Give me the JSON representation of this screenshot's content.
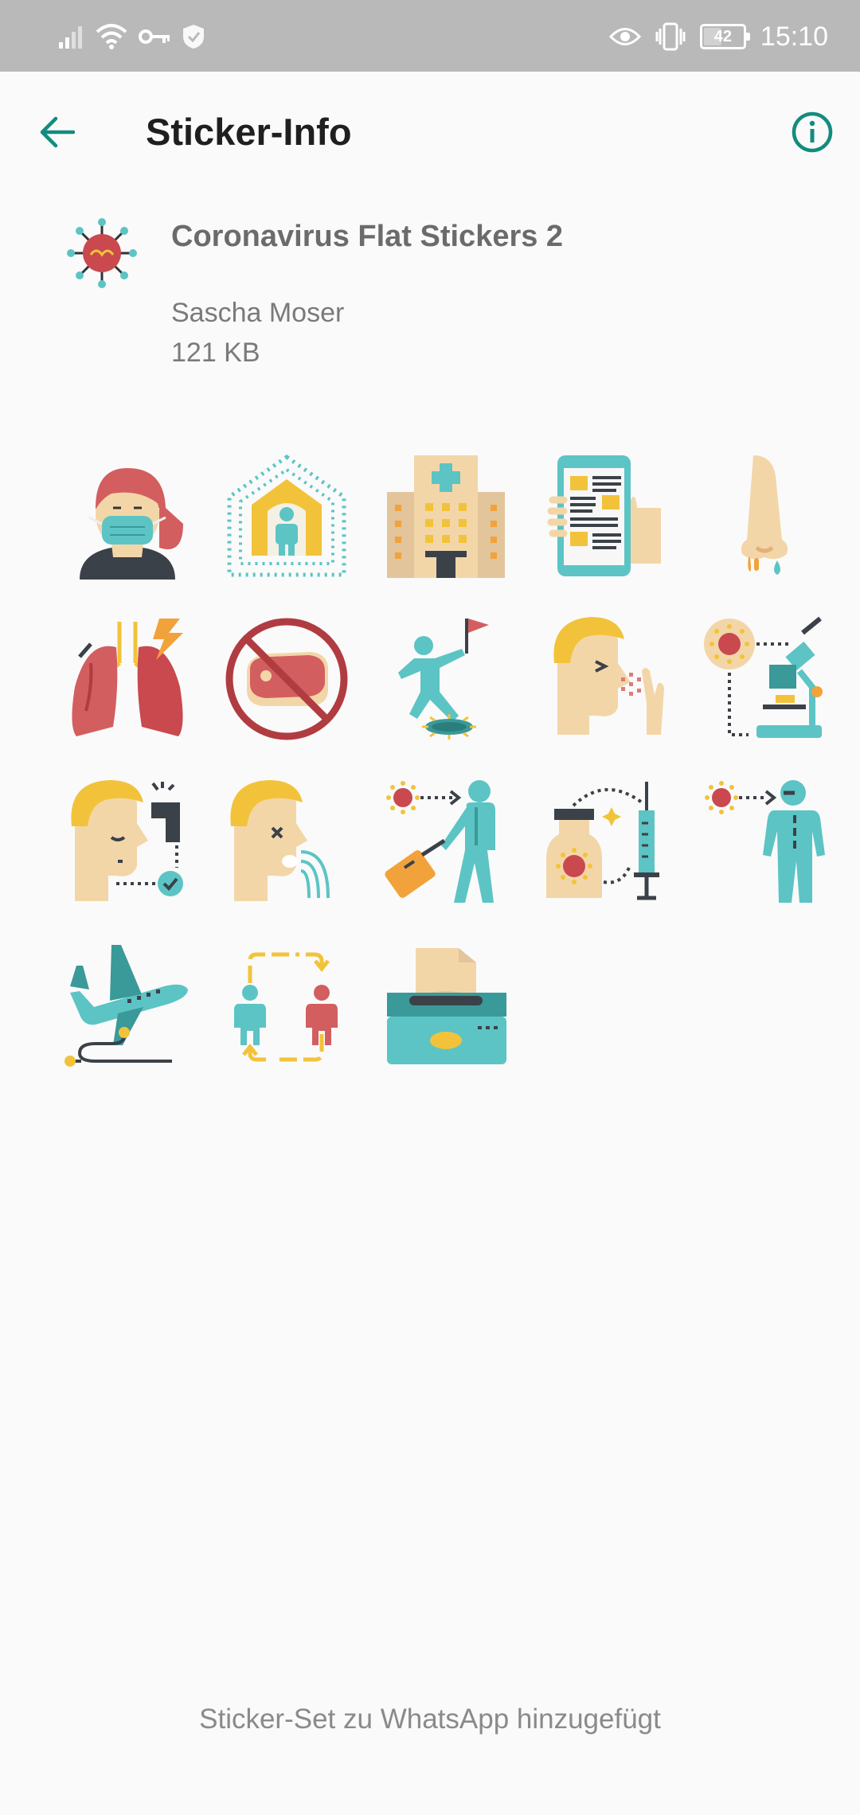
{
  "status_bar": {
    "time": "15:10",
    "battery_level": "42",
    "icons_left": [
      "signal-icon",
      "wifi-icon",
      "vpn-key-icon",
      "shield-icon"
    ],
    "icons_right": [
      "eye-icon",
      "vibrate-icon",
      "battery-icon"
    ]
  },
  "app_bar": {
    "title": "Sticker-Info",
    "back_icon": "arrow-left-icon",
    "info_icon": "info-icon"
  },
  "pack": {
    "name": "Coronavirus Flat Stickers 2",
    "author": "Sascha Moser",
    "size": "121 KB",
    "tray_icon": "virus-icon"
  },
  "stickers": [
    "woman-mask-icon",
    "house-quarantine-icon",
    "hospital-icon",
    "phone-news-icon",
    "nose-icon",
    "lungs-icon",
    "no-meat-icon",
    "flag-virus-icon",
    "head-sneeze-icon",
    "microscope-icon",
    "head-thermometer-icon",
    "head-cough-icon",
    "traveler-virus-icon",
    "vaccine-icon",
    "person-virus-icon",
    "airplane-icon",
    "person-transmission-icon",
    "tissue-box-icon"
  ],
  "colors": {
    "accent": "#128c7e",
    "status_bar": "#b9b9b9",
    "background": "#fafafa",
    "teal": "#5cc4c4",
    "red": "#d35e5f",
    "yellow": "#f2c33a",
    "skin": "#f3d6a8"
  },
  "footer": {
    "status_text": "Sticker-Set zu WhatsApp hinzugefügt"
  }
}
